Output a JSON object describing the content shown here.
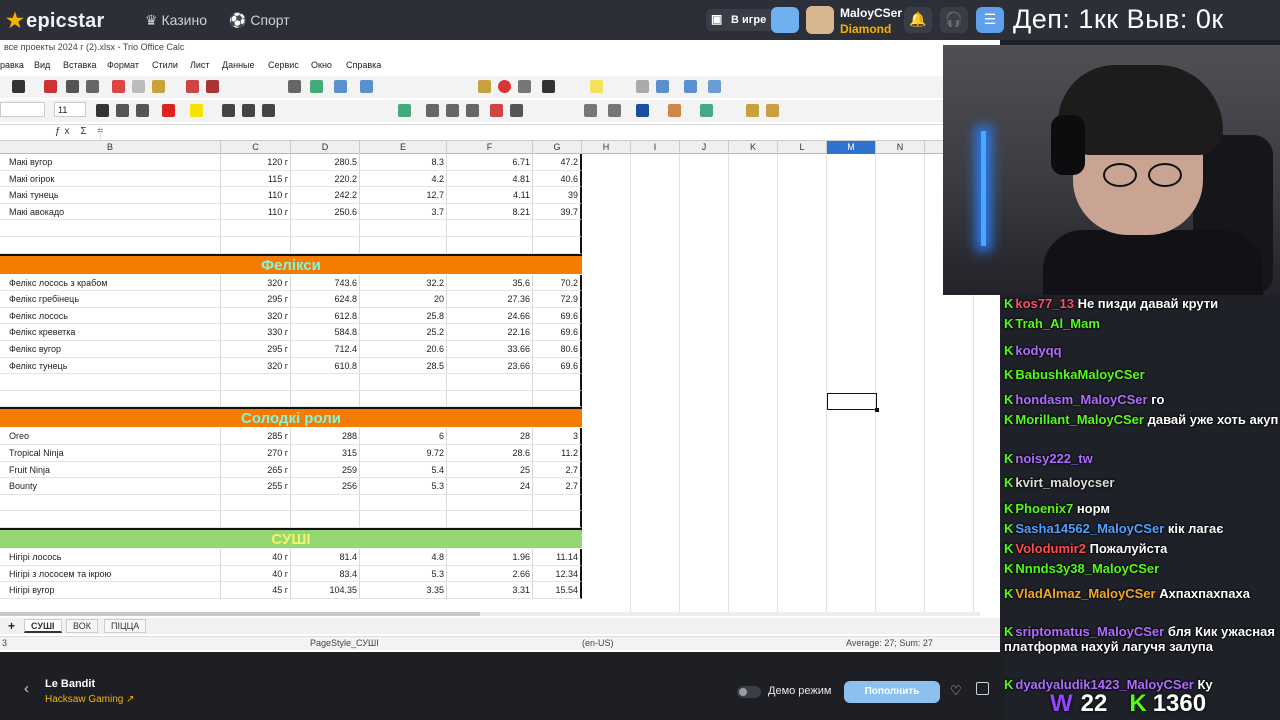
{
  "topbar": {
    "logo": "epicstar",
    "nav": [
      "Казино",
      "Спорт"
    ],
    "in_game_label": "В игре",
    "user_name": "MaloyCSer",
    "user_rank": "Diamond",
    "overlay_text": "Деп: 1кк  Выв: 0к"
  },
  "calc": {
    "window_title": "все проекты 2024 г (2).xlsx - Trio Office Calc",
    "menu": [
      "равка",
      "Вид",
      "Вставка",
      "Формат",
      "Стили",
      "Лист",
      "Данные",
      "Сервис",
      "Окно",
      "Справка"
    ],
    "font_size": "11",
    "formula_icons": "ƒx Σ =",
    "columns": [
      "B",
      "C",
      "D",
      "E",
      "F",
      "G",
      "H",
      "I",
      "J",
      "K",
      "L",
      "M",
      "N"
    ],
    "selected_column": "M",
    "rows_top": [
      [
        "Макі вугор",
        "120 г",
        "280.5",
        "8.3",
        "6.71",
        "47.2"
      ],
      [
        "Макі огірок",
        "115 г",
        "220.2",
        "4.2",
        "4.81",
        "40.6"
      ],
      [
        "Макі тунець",
        "110 г",
        "242.2",
        "12.7",
        "4.11",
        "39"
      ],
      [
        "Макі авокадо",
        "110 г",
        "250.6",
        "3.7",
        "8.21",
        "39.7"
      ]
    ],
    "section_feliksi": "Фелікси",
    "rows_feliksi": [
      [
        "Фелікс лосось з крабом",
        "320 г",
        "743.6",
        "32.2",
        "35.6",
        "70.2"
      ],
      [
        "Фелікс гребінець",
        "295 г",
        "624.8",
        "20",
        "27.36",
        "72.9"
      ],
      [
        "Фелікс лосось",
        "320 г",
        "612.8",
        "25.8",
        "24.66",
        "69.6"
      ],
      [
        "Фелікс креветка",
        "330 г",
        "584.8",
        "25.2",
        "22.16",
        "69.6"
      ],
      [
        "Фелікс вугор",
        "295 г",
        "712.4",
        "20.6",
        "33.66",
        "80.6"
      ],
      [
        "Фелікс тунець",
        "320 г",
        "610.8",
        "28.5",
        "23.66",
        "69.6"
      ]
    ],
    "section_sweet": "Солодкі роли",
    "rows_sweet": [
      [
        "Oreo",
        "285 г",
        "288",
        "6",
        "28",
        "3"
      ],
      [
        "Tropical Ninja",
        "270 г",
        "315",
        "9.72",
        "28.6",
        "11.2"
      ],
      [
        "Fruit Ninja",
        "265 г",
        "259",
        "5.4",
        "25",
        "2.7"
      ],
      [
        "Bounty",
        "255 г",
        "256",
        "5.3",
        "24",
        "2.7"
      ]
    ],
    "section_sushi": "СУШІ",
    "rows_sushi": [
      [
        "Нігірі лосось",
        "40 г",
        "81.4",
        "4.8",
        "1.96",
        "11.14"
      ],
      [
        "Нігірі з лососем та ікрою",
        "40 г",
        "83.4",
        "5.3",
        "2.66",
        "12.34"
      ],
      [
        "Нігірі вугор",
        "45 г",
        "104.35",
        "3.35",
        "3.31",
        "15.54"
      ]
    ],
    "sheet_tabs": [
      "СУШІ",
      "ВОК",
      "ПІЦЦА"
    ],
    "active_tab": "СУШІ",
    "status_page_style": "PageStyle_СУШІ",
    "status_lang": "(en-US)",
    "status_sum": "Average: 27; Sum: 27",
    "status_left": "3"
  },
  "chat": [
    {
      "user": "kos77_13",
      "color": "#ff4d6a",
      "text": "Не пизди давай крути"
    },
    {
      "user": "Trah_Al_Mam",
      "color": "#53fc18",
      "text": ""
    },
    {
      "user": "kodyqq",
      "color": "#b06bff",
      "text": ""
    },
    {
      "user": "BabushkaMaloyCSer",
      "color": "#53fc18",
      "text": ""
    },
    {
      "user": "hondasm_MaloyCSer",
      "color": "#b06bff",
      "text": "го"
    },
    {
      "user": "Morillant_MaloyCSer",
      "color": "#53fc18",
      "text": "давай уже хоть акуп"
    },
    {
      "user": "noisy222_tw",
      "color": "#b06bff",
      "text": ""
    },
    {
      "user": "kvirt_maloycser",
      "color": "#dddddd",
      "text": ""
    },
    {
      "user": "Phoenix7",
      "color": "#53fc18",
      "text": "норм"
    },
    {
      "user": "Sasha14562_MaloyCSer",
      "color": "#4da3ff",
      "text": "кік лагає"
    },
    {
      "user": "Volodumir2",
      "color": "#ff4d4d",
      "text": "Пожалуйста"
    },
    {
      "user": "Nnnds3y38_MaloyCSer",
      "color": "#53fc18",
      "text": ""
    },
    {
      "user": "VladAlmaz_MaloyCSer",
      "color": "#f5a623",
      "text": "Ахпахпахпаха"
    },
    {
      "user": "sriptomatus_MaloyCSer",
      "color": "#b06bff",
      "text": "бля Кик ужасная платформа нахуй лагучя залупа"
    },
    {
      "user": "dyadyaludik1423_MaloyCSer",
      "color": "#b06bff",
      "text": "Ку"
    }
  ],
  "bottombar": {
    "game_title": "Le Bandit",
    "provider": "Hacksaw Gaming",
    "demo_label": "Демо режим",
    "topup_label": "Пополнить"
  },
  "stream_stats": {
    "subs": "22",
    "kicks": "1360"
  }
}
